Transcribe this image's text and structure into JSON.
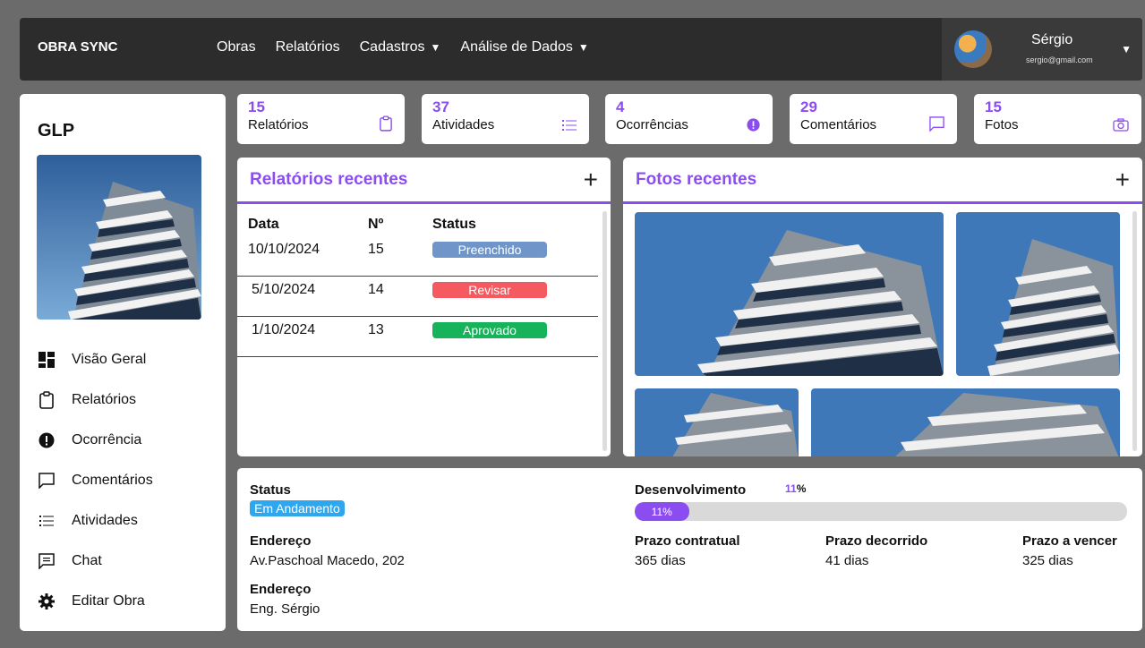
{
  "brand": "OBRA SYNC",
  "nav": [
    {
      "label": "Obras",
      "caret": ""
    },
    {
      "label": "Relatórios",
      "caret": ""
    },
    {
      "label": "Cadastros",
      "caret": "▼"
    },
    {
      "label": "Análise de Dados",
      "caret": "▼"
    }
  ],
  "user": {
    "name": "Sérgio",
    "email": "sergio@gmail.com",
    "caret": "▼"
  },
  "project": {
    "title": "GLP"
  },
  "sidebar_menu": [
    {
      "icon": "dashboard-icon",
      "label": "Visão Geral"
    },
    {
      "icon": "clipboard-icon",
      "label": "Relatórios"
    },
    {
      "icon": "alert-icon",
      "label": "Ocorrência"
    },
    {
      "icon": "comment-icon",
      "label": "Comentários"
    },
    {
      "icon": "list-icon",
      "label": "Atividades"
    },
    {
      "icon": "chat-icon",
      "label": "Chat"
    },
    {
      "icon": "gear-icon",
      "label": "Editar Obra"
    }
  ],
  "stats": [
    {
      "value": "15",
      "label": "Relatórios",
      "icon": "clipboard-icon"
    },
    {
      "value": "37",
      "label": "Atividades",
      "icon": "list-icon"
    },
    {
      "value": "4",
      "label": "Ocorrências",
      "icon": "alert-icon"
    },
    {
      "value": "29",
      "label": "Comentários",
      "icon": "comment-icon"
    },
    {
      "value": "15",
      "label": "Fotos",
      "icon": "camera-icon"
    }
  ],
  "reports": {
    "title": "Relatórios recentes",
    "add": "+",
    "columns": [
      "Data",
      "Nº",
      "Status"
    ],
    "rows": [
      {
        "date": "10/10/2024",
        "num": "15",
        "status": "Preenchido",
        "color": "#6f95c9"
      },
      {
        "date": "5/10/2024",
        "num": "14",
        "status": "Revisar",
        "color": "#f45a5f"
      },
      {
        "date": "1/10/2024",
        "num": "13",
        "status": "Aprovado",
        "color": "#16b35a"
      }
    ]
  },
  "photos": {
    "title": "Fotos recentes",
    "add": "+"
  },
  "summary": {
    "status_label": "Status",
    "status_value": "Em Andamento",
    "address_label": "Endereço",
    "address_value": "Av.Paschoal Macedo, 202",
    "engineer_label": "Endereço",
    "engineer_value": "Eng. Sérgio",
    "dev_label": "Desenvolvimento",
    "dev_value_num": "11",
    "dev_value_pct": "%",
    "dev_progress": 0.11,
    "dev_bar_text": "11%",
    "prazo_contratual_label": "Prazo contratual",
    "prazo_contratual_value": "365 dias",
    "prazo_decorrido_label": "Prazo decorrido",
    "prazo_decorrido_value": "41 dias",
    "prazo_vencer_label": "Prazo a vencer",
    "prazo_vencer_value": "325 dias"
  },
  "colors": {
    "accent": "#8b4cf0",
    "topbar": "#2c2c2c",
    "background": "#6b6b6b"
  }
}
